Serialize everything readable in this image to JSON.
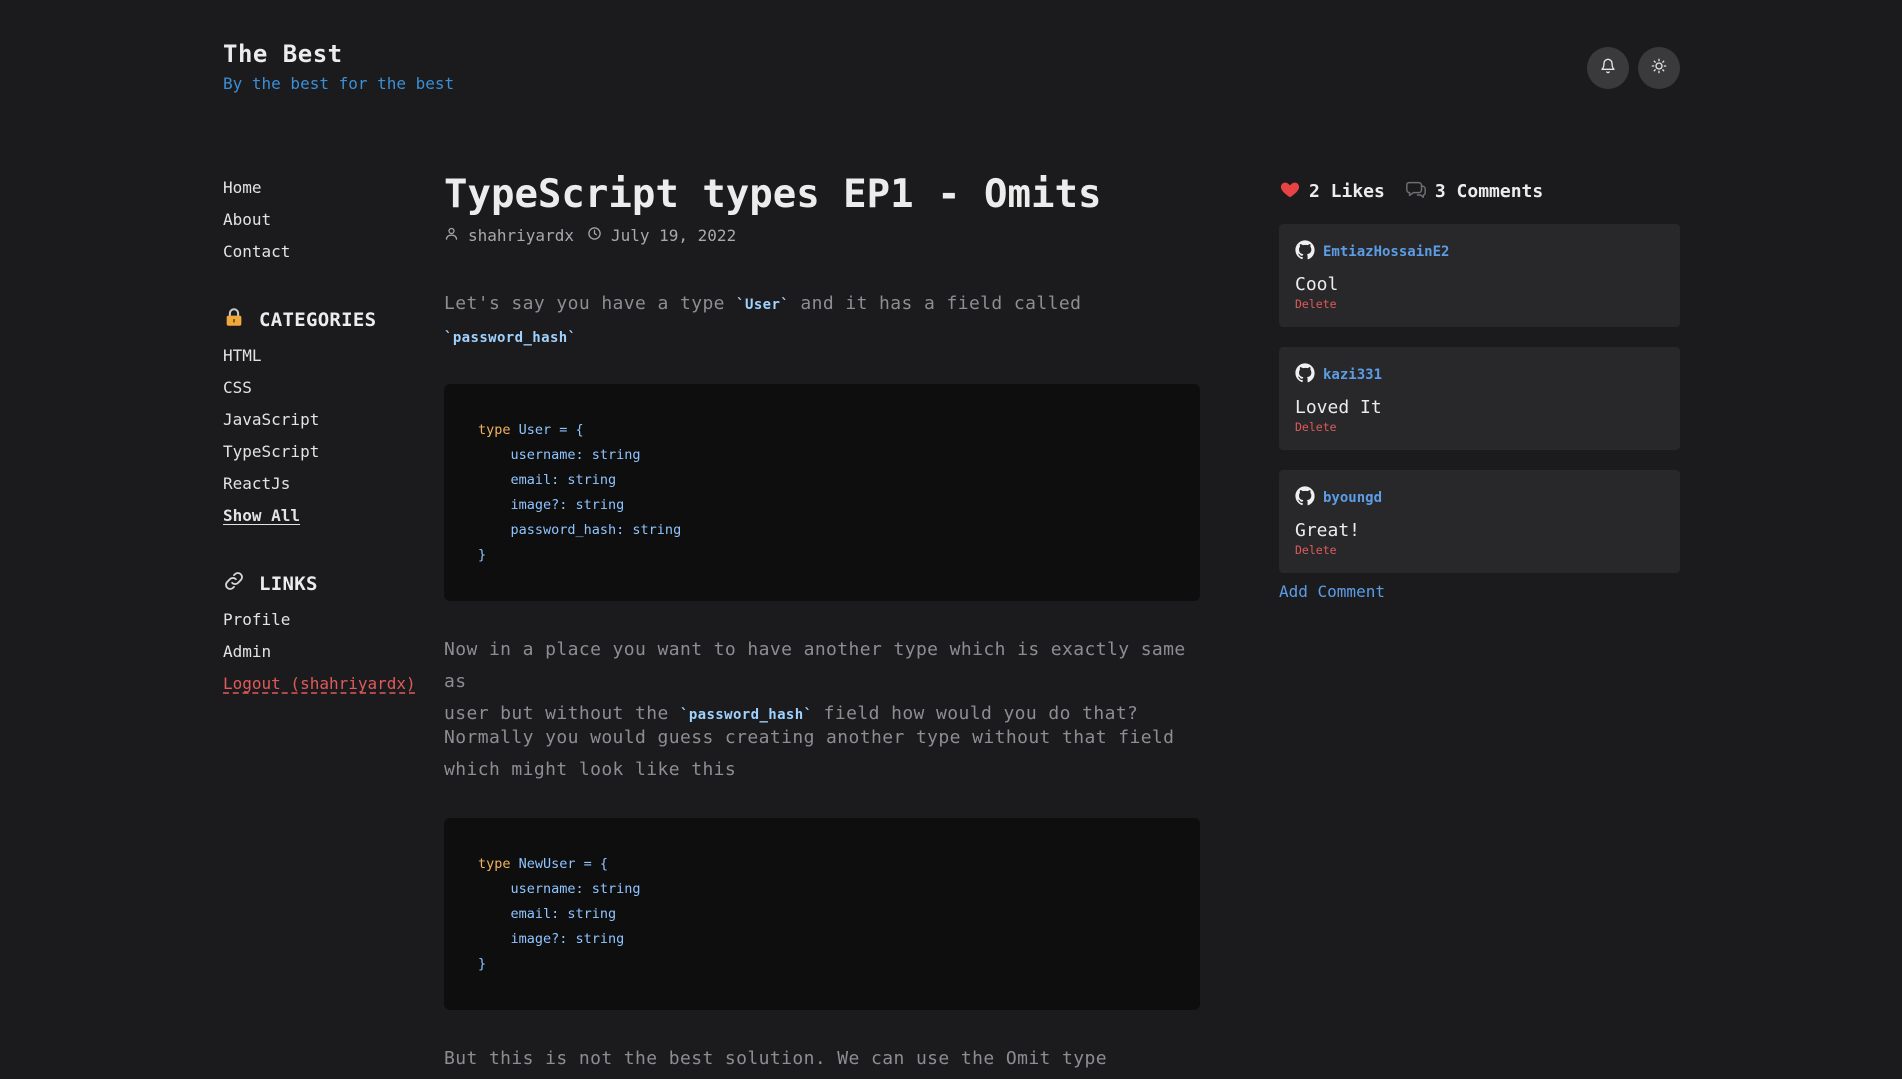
{
  "site": {
    "title": "The Best",
    "tagline": "By the best for the best"
  },
  "header_buttons": [
    {
      "icon": "bell-icon"
    },
    {
      "icon": "sun-icon"
    }
  ],
  "nav": {
    "primary": [
      "Home",
      "About",
      "Contact"
    ],
    "categories_heading": "CATEGORIES",
    "categories": [
      "HTML",
      "CSS",
      "JavaScript",
      "TypeScript",
      "ReactJs"
    ],
    "show_all": "Show All",
    "links_heading": "LINKS",
    "links": [
      "Profile",
      "Admin"
    ],
    "logout": "Logout (shahriyardx)"
  },
  "post": {
    "title": "TypeScript types EP1 - Omits",
    "author": "shahriyardx",
    "date": "July 19, 2022",
    "p1_before": "Let's say you have a type ",
    "p1_code1": "`User`",
    "p1_mid": " and it has a field called",
    "p1_code2": "`password_hash`",
    "code1": [
      "type User = {",
      "    username: string",
      "    email: string",
      "    image?: string",
      "    password_hash: string",
      "}"
    ],
    "code1_kw": "type",
    "code1_first_rest": " User = {",
    "p2_line1": "Now in a place you want to have another type which is exactly same as",
    "p2_before": "user but without the ",
    "p2_code": "`password_hash`",
    "p2_after": " field how would you do that?",
    "p3_line1": "Normally you would guess creating another type without that field",
    "p3_line2": "which might look like this",
    "code2_kw": "type",
    "code2_first_rest": " NewUser = {",
    "code2_rest": [
      "    username: string",
      "    email: string",
      "    image?: string",
      "}"
    ],
    "p4": "But this is not the best solution. We can use the Omit type"
  },
  "stats": {
    "likes": "2 Likes",
    "comments": "3 Comments"
  },
  "comments": [
    {
      "author": "EmtiazHossainE2",
      "body": "Cool",
      "delete": "Delete"
    },
    {
      "author": "kazi331",
      "body": "Loved It",
      "delete": "Delete"
    },
    {
      "author": "byoungd",
      "body": "Great!",
      "delete": "Delete"
    }
  ],
  "add_comment": "Add Comment",
  "colors": {
    "background": "#1b1b1d",
    "accent_blue": "#5c9de6",
    "danger_red": "#e05a5a",
    "code_keyword": "#f3b35c",
    "code_text": "#8fc4ff"
  }
}
